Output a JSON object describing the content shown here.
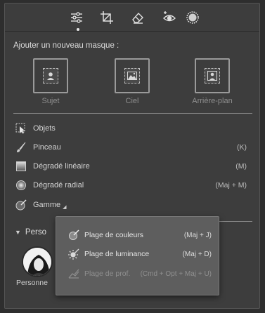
{
  "toolbar": {
    "tools": [
      {
        "name": "edit-sliders-icon"
      },
      {
        "name": "crop-icon"
      },
      {
        "name": "eraser-icon"
      },
      {
        "name": "red-eye-icon"
      },
      {
        "name": "masking-icon"
      }
    ],
    "active_index": 0
  },
  "add_mask": {
    "heading": "Ajouter un nouveau masque :",
    "buttons": [
      {
        "label": "Sujet",
        "icon": "person-icon"
      },
      {
        "label": "Ciel",
        "icon": "sky-image-icon"
      },
      {
        "label": "Arrière-plan",
        "icon": "background-icon"
      }
    ]
  },
  "tools_list": [
    {
      "label": "Objets",
      "shortcut": "",
      "icon": "object-select-icon"
    },
    {
      "label": "Pinceau",
      "shortcut": "(K)",
      "icon": "brush-icon"
    },
    {
      "label": "Dégradé linéaire",
      "shortcut": "(M)",
      "icon": "linear-gradient-icon"
    },
    {
      "label": "Dégradé radial",
      "shortcut": "(Maj + M)",
      "icon": "radial-gradient-icon"
    },
    {
      "label": "Gamme",
      "shortcut": "",
      "icon": "range-icon"
    }
  ],
  "people_section": {
    "title": "Perso",
    "person_label": "Personne"
  },
  "range_popup": {
    "items": [
      {
        "label": "Plage de couleurs",
        "shortcut": "(Maj + J)",
        "disabled": false,
        "icon": "color-range-icon"
      },
      {
        "label": "Plage de luminance",
        "shortcut": "(Maj + D)",
        "disabled": false,
        "icon": "luminance-range-icon"
      },
      {
        "label": "Plage de prof.",
        "shortcut": "(Cmd + Opt + Maj + U)",
        "disabled": true,
        "icon": "depth-range-icon"
      }
    ]
  },
  "colors": {
    "panel_bg": "#3d3d3d",
    "popup_bg": "#5e5e5e",
    "text": "#d2d2d2",
    "disabled_text": "#8f8f8f"
  }
}
